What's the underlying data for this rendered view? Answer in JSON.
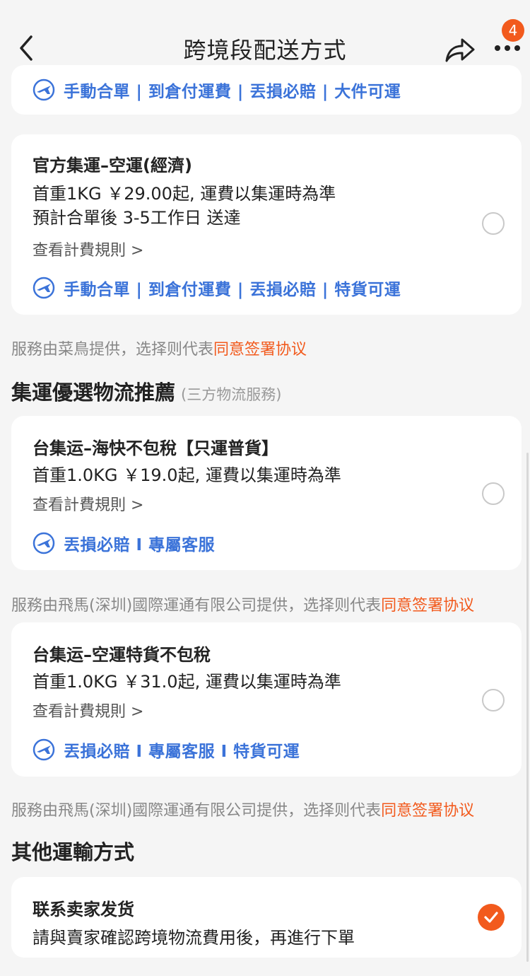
{
  "header": {
    "title": "跨境段配送方式",
    "badge_count": "4",
    "back_icon": "chevron-left-icon",
    "share_icon": "share-icon",
    "more_icon": "more-dots-icon"
  },
  "colors": {
    "accent": "#f25a1d",
    "tag_blue": "#3b73d9",
    "background": "#f5f5f5"
  },
  "top_partial_card": {
    "tags": "手動合單 | 到倉付運費 | 丟損必賠 | 大件可運"
  },
  "official_air_card": {
    "title": "官方集運–空運(經濟)",
    "price_line": "首重1KG ￥29.00起, 運費以集運時為準",
    "eta_line": "預計合單後 3-5工作日 送達",
    "rule_link": "查看計費規則 >",
    "tags": "手動合單 | 到倉付運費 | 丟損必賠 | 特貨可運",
    "selected": false
  },
  "note_cainiao": {
    "text": "服務由菜鳥提供，选择则代表",
    "agree": "同意签署协议"
  },
  "section_recommend": {
    "title": "集運優選物流推薦",
    "subtitle": "(三方物流服務)"
  },
  "sea_card": {
    "title": "台集运–海快不包稅【只運普貨】",
    "price_line": "首重1.0KG ￥19.0起, 運費以集運時為準",
    "rule_link": "查看計費規則 >",
    "tags": "丟損必賠 I 專屬客服",
    "selected": false
  },
  "note_feima_1": {
    "text": "服務由飛馬(深圳)國際運通有限公司提供，选择则代表",
    "agree": "同意签署协议"
  },
  "air_special_card": {
    "title": "台集运–空運特貨不包稅",
    "price_line": "首重1.0KG ￥31.0起, 運費以集運時為準",
    "rule_link": "查看計費規則 >",
    "tags": "丟損必賠 I 專屬客服 I 特貨可運",
    "selected": false
  },
  "note_feima_2": {
    "text": "服務由飛馬(深圳)國際運通有限公司提供，选择则代表",
    "agree": "同意签署协议"
  },
  "section_other": {
    "title": "其他運輸方式"
  },
  "seller_card": {
    "title": "联系卖家发货",
    "desc": "請與賣家確認跨境物流費用後，再進行下單",
    "selected": true
  }
}
